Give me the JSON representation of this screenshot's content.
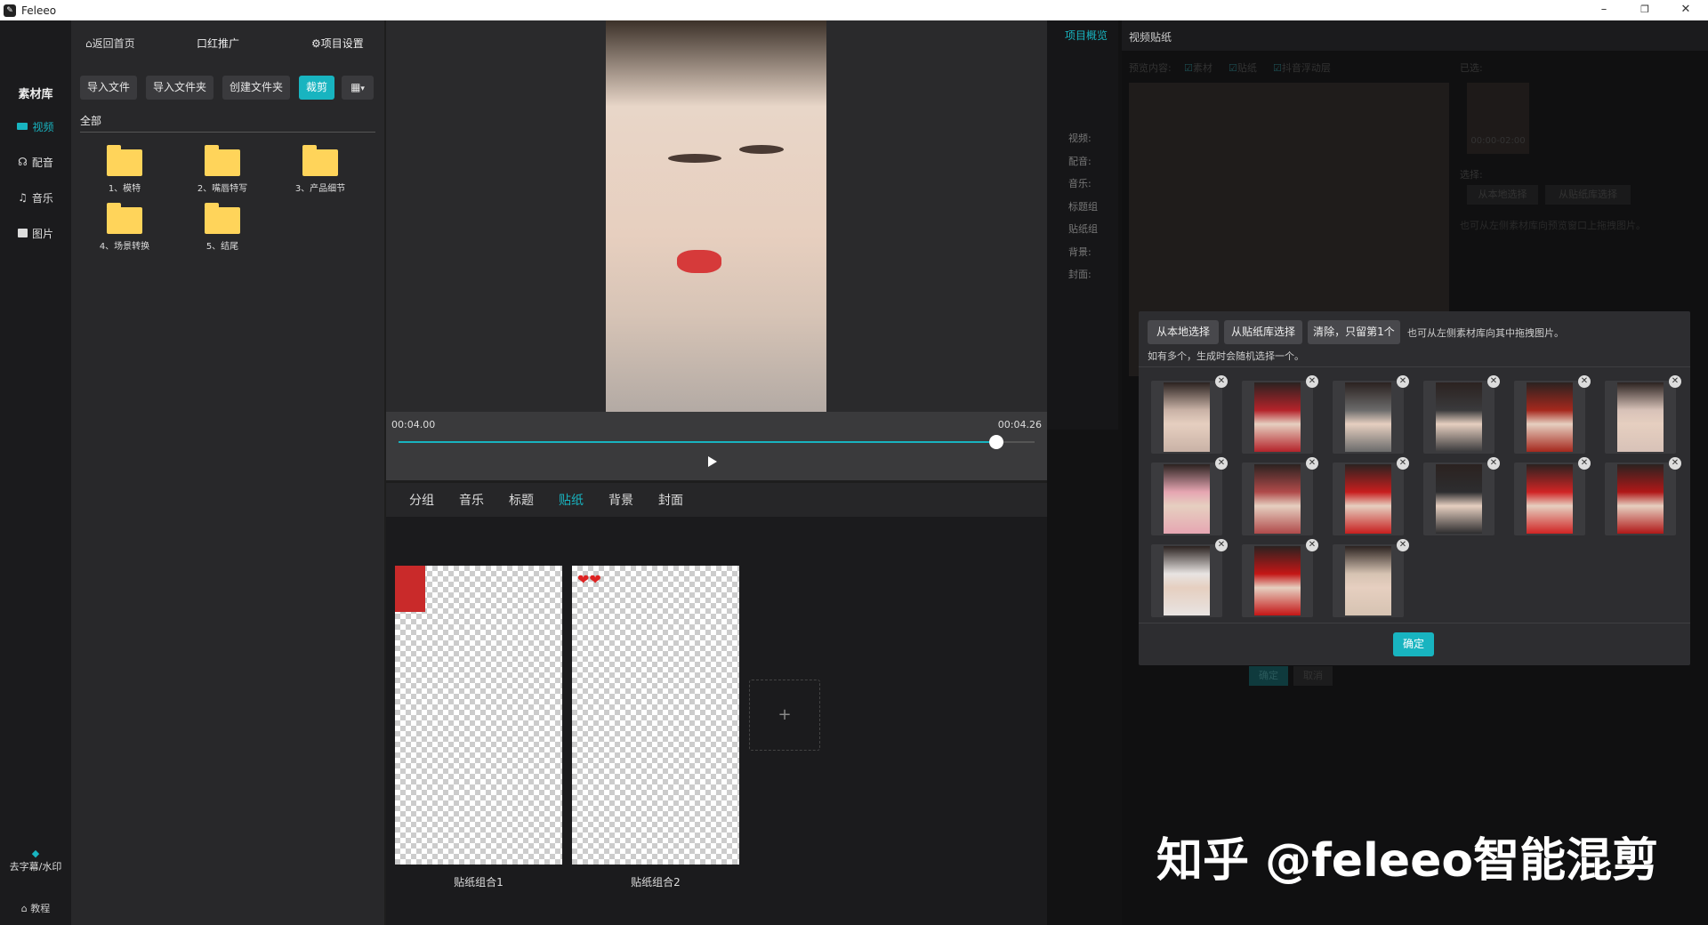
{
  "window": {
    "title": "Feleeo",
    "minimize": "–",
    "restore": "❐",
    "close": "✕"
  },
  "sidebar": {
    "title": "素材库",
    "items": [
      {
        "label": "视频",
        "icon": "video-icon"
      },
      {
        "label": "配音",
        "icon": "voice-icon"
      },
      {
        "label": "音乐",
        "icon": "music-icon"
      },
      {
        "label": "图片",
        "icon": "image-icon"
      }
    ],
    "watermark": "去字幕/水印",
    "tutorial": "教程"
  },
  "library": {
    "back": "返回首页",
    "project": "口红推广",
    "settings": "项目设置",
    "buttons": [
      "导入文件",
      "导入文件夹",
      "创建文件夹",
      "裁剪"
    ],
    "breadcrumb": "全部",
    "folders": [
      "1、模特",
      "2、嘴唇特写",
      "3、产品细节",
      "4、场景转换",
      "5、结尾"
    ]
  },
  "player": {
    "time_current": "00:04.00",
    "time_total": "00:04.26",
    "progress": 0.94
  },
  "tabs": {
    "items": [
      "分组",
      "音乐",
      "标题",
      "贴纸",
      "背景",
      "封面"
    ],
    "active": 3
  },
  "sticker_groups": [
    "贴纸组合1",
    "贴纸组合2"
  ],
  "add_label": "+",
  "overview": {
    "title": "项目概览",
    "rows": [
      "视频:",
      "配音:",
      "音乐:",
      "标题组",
      "贴纸组",
      "背景:",
      "封面:"
    ]
  },
  "bgpanel": {
    "title": "视频贴纸",
    "preview_label": "预览内容:",
    "checks": [
      "素材",
      "贴纸",
      "抖音浮动层"
    ],
    "selected_label": "已选:",
    "duration": "00:00-02:00",
    "choose_label": "选择:",
    "local": "从本地选择",
    "library": "从贴纸库选择",
    "hint": "也可从左侧素材库向预览窗口上拖拽图片。",
    "confirm": "确定",
    "cancel": "取消"
  },
  "modal": {
    "btn_local": "从本地选择",
    "btn_library": "从贴纸库选择",
    "btn_clear": "清除，只留第1个",
    "hint1": "也可从左侧素材库向其中拖拽图片。",
    "hint2": "如有多个，生成时会随机选择一个。",
    "confirm": "确定",
    "count": 15
  },
  "watermark": "知乎 @feleeo智能混剪",
  "colors": {
    "accent": "#18b4c0",
    "folder": "#ffd45a"
  }
}
